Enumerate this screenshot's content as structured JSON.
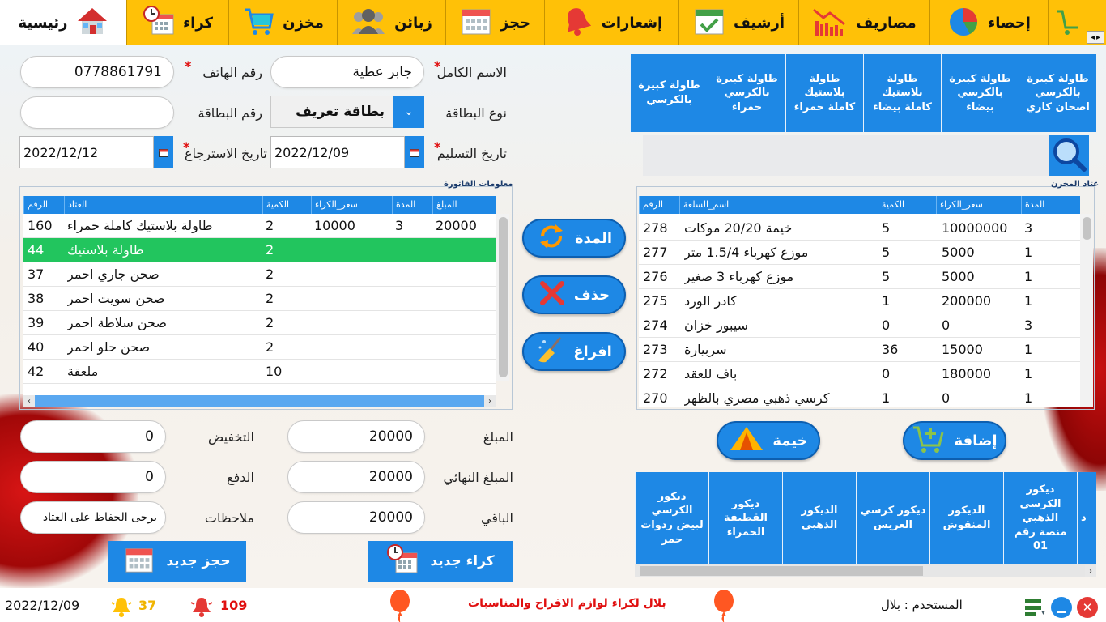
{
  "nav": {
    "tabs": [
      {
        "label": "رئيسية",
        "icon": "home-icon"
      },
      {
        "label": "كراء",
        "icon": "clock-calendar-icon"
      },
      {
        "label": "مخزن",
        "icon": "cart-icon"
      },
      {
        "label": "زبائن",
        "icon": "users-icon"
      },
      {
        "label": "حجز",
        "icon": "calendar-icon"
      },
      {
        "label": "إشعارات",
        "icon": "bell-icon"
      },
      {
        "label": "أرشيف",
        "icon": "calendar-check-icon"
      },
      {
        "label": "مصاريف",
        "icon": "bar-chart-down-icon"
      },
      {
        "label": "إحصاء",
        "icon": "pie-chart-icon"
      }
    ]
  },
  "form": {
    "full_name_label": "الاسم الكامل",
    "full_name": "جابر عطية",
    "phone_label": "رقم الهاتف",
    "phone": "0778861791",
    "card_type_label": "نوع البطاقة",
    "card_type": "بطاقة تعريف",
    "card_number_label": "رقم البطاقة",
    "card_number": "",
    "delivery_date_label": "تاريخ التسليم",
    "delivery_date": "2022/12/09",
    "return_date_label": "تاريخ الاسترجاع",
    "return_date": "2022/12/12",
    "required_mark": "*"
  },
  "invoice": {
    "title": "معلومات الفاتورة",
    "columns": [
      "الرقم",
      "العتاد",
      "الكمية",
      "سعر_الكراء",
      "المدة",
      "المبلغ"
    ],
    "rows": [
      {
        "id": "160",
        "item": "طاولة بلاستيك كاملة حمراء",
        "qty": "2",
        "price": "10000",
        "duration": "3",
        "amount": "20000"
      },
      {
        "id": "44",
        "item": "طاولة بلاستيك",
        "qty": "2",
        "price": "",
        "duration": "",
        "amount": ""
      },
      {
        "id": "37",
        "item": "صحن جاري احمر",
        "qty": "2",
        "price": "",
        "duration": "",
        "amount": ""
      },
      {
        "id": "38",
        "item": "صحن سويت احمر",
        "qty": "2",
        "price": "",
        "duration": "",
        "amount": ""
      },
      {
        "id": "39",
        "item": "صحن سلاطة احمر",
        "qty": "2",
        "price": "",
        "duration": "",
        "amount": ""
      },
      {
        "id": "40",
        "item": "صحن حلو احمر",
        "qty": "2",
        "price": "",
        "duration": "",
        "amount": ""
      },
      {
        "id": "42",
        "item": "ملعقة",
        "qty": "10",
        "price": "",
        "duration": "",
        "amount": ""
      }
    ]
  },
  "middle_buttons": {
    "duration": "المدة",
    "delete": "حذف",
    "clear": "افراغ"
  },
  "store": {
    "title": "عتاد المخزن",
    "columns": [
      "الرقم",
      "اسم_السلعة",
      "الكمية",
      "سعر_الكراء",
      "المدة"
    ],
    "rows": [
      {
        "id": "278",
        "name": "خيمة 20/20 موكات",
        "qty": "5",
        "price": "10000000",
        "duration": "3"
      },
      {
        "id": "277",
        "name": "موزع كهرباء 1.5/4 متر",
        "qty": "5",
        "price": "5000",
        "duration": "1"
      },
      {
        "id": "276",
        "name": "موزع كهرباء 3 صغير",
        "qty": "5",
        "price": "5000",
        "duration": "1"
      },
      {
        "id": "275",
        "name": "كادر الورد",
        "qty": "1",
        "price": "200000",
        "duration": "1"
      },
      {
        "id": "274",
        "name": "سيبور خزان",
        "qty": "0",
        "price": "0",
        "duration": "3"
      },
      {
        "id": "273",
        "name": "سربيارة",
        "qty": "36",
        "price": "15000",
        "duration": "1"
      },
      {
        "id": "272",
        "name": "باف للعقد",
        "qty": "0",
        "price": "180000",
        "duration": "1"
      },
      {
        "id": "270",
        "name": "كرسي ذهبي مصري بالظهر",
        "qty": "1",
        "price": "0",
        "duration": "1"
      }
    ],
    "add_button": "إضافة",
    "tent_button": "خيمة"
  },
  "top_tiles": [
    "طاولة كبيرة بالكرسي اصحان كاري",
    "طاولة كبيرة بالكرسي بيضاء",
    "طاولة بلاستيك كاملة بيضاء",
    "طاولة بلاستيك كاملة حمراء",
    "طاولة كبيرة بالكرسي حمراء",
    "طاولة كبيرة بالكرسي"
  ],
  "bottom_tiles": [
    "ديكور الكرسي الذهبي منصة رقم 01",
    "الديكور المنقوش",
    "ديكور كرسي العريس",
    "الديكور الذهبي",
    "ديكور القطيفة الحمراء",
    "ديكور الكرسي لبيض ردوات حمر"
  ],
  "bottom_tiles_partial": "د",
  "totals": {
    "amount_label": "المبلغ",
    "amount": "20000",
    "final_label": "المبلغ النهائي",
    "final": "20000",
    "remaining_label": "الباقي",
    "remaining": "20000",
    "discount_label": "التخفيض",
    "discount": "0",
    "payment_label": "الدفع",
    "payment": "0",
    "notes_label": "ملاحظات",
    "notes": "برجى الحفاظ على العتاد"
  },
  "actions": {
    "new_rental": "كراء جديد",
    "new_booking": "حجز جديد"
  },
  "status": {
    "date": "2022/12/09",
    "notif_yellow": "37",
    "notif_red": "109",
    "slogan": "بلال لكراء لوازم الافراح والمناسبات",
    "user": "المستخدم : بلال"
  },
  "colors": {
    "nav_bg": "#ffc107",
    "accent": "#1e88e5",
    "selected_row": "#22c55e",
    "required": "#e01010"
  }
}
